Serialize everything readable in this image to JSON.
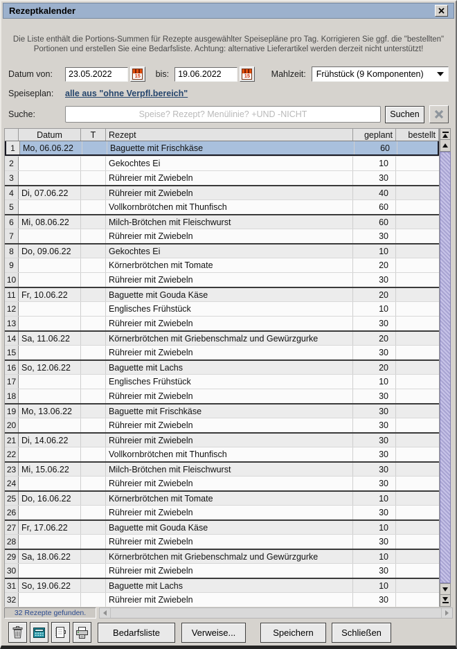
{
  "window": {
    "title": "Rezeptkalender"
  },
  "description": {
    "line1": "Die Liste enthält die Portions-Summen für Rezepte ausgewählter Speisepläne pro Tag. Korrigieren Sie ggf. die \"bestellten\"",
    "line2": "Portionen und erstellen Sie eine Bedarfsliste. Achtung: alternative Lieferartikel werden derzeit nicht unterstützt!"
  },
  "filters": {
    "date_from_label": "Datum von:",
    "date_from_value": "23.05.2022",
    "date_to_label": "bis:",
    "date_to_value": "19.06.2022",
    "calendar_day": "15",
    "meal_label": "Mahlzeit:",
    "meal_value": "Frühstück (9 Komponenten)",
    "mealplan_label": "Speiseplan:",
    "mealplan_link": "alle aus \"ohne Verpfl.bereich\"",
    "search_label": "Suche:",
    "search_placeholder": "Speise? Rezept? Menülinie? +UND -NICHT",
    "search_button": "Suchen"
  },
  "table": {
    "columns": [
      "",
      "Datum",
      "T",
      "Rezept",
      "geplant",
      "bestellt"
    ],
    "rows": [
      {
        "num": 1,
        "date": "Mo, 06.06.22",
        "t": "",
        "recipe": "Baguette mit Frischkäse",
        "planned": "60",
        "ordered": "",
        "day_start": true,
        "selected": true
      },
      {
        "num": 2,
        "date": "",
        "t": "",
        "recipe": "Gekochtes Ei",
        "planned": "10",
        "ordered": "",
        "day_start": false,
        "selected": false
      },
      {
        "num": 3,
        "date": "",
        "t": "",
        "recipe": "Rühreier mit Zwiebeln",
        "planned": "30",
        "ordered": "",
        "day_start": false,
        "selected": false
      },
      {
        "num": 4,
        "date": "Di, 07.06.22",
        "t": "",
        "recipe": "Rühreier mit Zwiebeln",
        "planned": "40",
        "ordered": "",
        "day_start": true,
        "selected": false
      },
      {
        "num": 5,
        "date": "",
        "t": "",
        "recipe": "Vollkornbrötchen mit Thunfisch",
        "planned": "60",
        "ordered": "",
        "day_start": false,
        "selected": false
      },
      {
        "num": 6,
        "date": "Mi, 08.06.22",
        "t": "",
        "recipe": "Milch-Brötchen mit Fleischwurst",
        "planned": "60",
        "ordered": "",
        "day_start": true,
        "selected": false
      },
      {
        "num": 7,
        "date": "",
        "t": "",
        "recipe": "Rühreier mit Zwiebeln",
        "planned": "30",
        "ordered": "",
        "day_start": false,
        "selected": false
      },
      {
        "num": 8,
        "date": "Do, 09.06.22",
        "t": "",
        "recipe": "Gekochtes Ei",
        "planned": "10",
        "ordered": "",
        "day_start": true,
        "selected": false
      },
      {
        "num": 9,
        "date": "",
        "t": "",
        "recipe": "Körnerbrötchen mit Tomate",
        "planned": "20",
        "ordered": "",
        "day_start": false,
        "selected": false
      },
      {
        "num": 10,
        "date": "",
        "t": "",
        "recipe": "Rühreier mit Zwiebeln",
        "planned": "30",
        "ordered": "",
        "day_start": false,
        "selected": false
      },
      {
        "num": 11,
        "date": "Fr, 10.06.22",
        "t": "",
        "recipe": "Baguette mit Gouda Käse",
        "planned": "20",
        "ordered": "",
        "day_start": true,
        "selected": false
      },
      {
        "num": 12,
        "date": "",
        "t": "",
        "recipe": "Englisches Frühstück",
        "planned": "10",
        "ordered": "",
        "day_start": false,
        "selected": false
      },
      {
        "num": 13,
        "date": "",
        "t": "",
        "recipe": "Rühreier mit Zwiebeln",
        "planned": "30",
        "ordered": "",
        "day_start": false,
        "selected": false
      },
      {
        "num": 14,
        "date": "Sa, 11.06.22",
        "t": "",
        "recipe": "Körnerbrötchen mit Griebenschmalz und Gewürzgurke",
        "planned": "20",
        "ordered": "",
        "day_start": true,
        "selected": false
      },
      {
        "num": 15,
        "date": "",
        "t": "",
        "recipe": "Rühreier mit Zwiebeln",
        "planned": "30",
        "ordered": "",
        "day_start": false,
        "selected": false
      },
      {
        "num": 16,
        "date": "So, 12.06.22",
        "t": "",
        "recipe": "Baguette mit Lachs",
        "planned": "20",
        "ordered": "",
        "day_start": true,
        "selected": false
      },
      {
        "num": 17,
        "date": "",
        "t": "",
        "recipe": "Englisches Frühstück",
        "planned": "10",
        "ordered": "",
        "day_start": false,
        "selected": false
      },
      {
        "num": 18,
        "date": "",
        "t": "",
        "recipe": "Rühreier mit Zwiebeln",
        "planned": "30",
        "ordered": "",
        "day_start": false,
        "selected": false
      },
      {
        "num": 19,
        "date": "Mo, 13.06.22",
        "t": "",
        "recipe": "Baguette mit Frischkäse",
        "planned": "30",
        "ordered": "",
        "day_start": true,
        "selected": false
      },
      {
        "num": 20,
        "date": "",
        "t": "",
        "recipe": "Rühreier mit Zwiebeln",
        "planned": "30",
        "ordered": "",
        "day_start": false,
        "selected": false
      },
      {
        "num": 21,
        "date": "Di, 14.06.22",
        "t": "",
        "recipe": "Rühreier mit Zwiebeln",
        "planned": "30",
        "ordered": "",
        "day_start": true,
        "selected": false
      },
      {
        "num": 22,
        "date": "",
        "t": "",
        "recipe": "Vollkornbrötchen mit Thunfisch",
        "planned": "30",
        "ordered": "",
        "day_start": false,
        "selected": false
      },
      {
        "num": 23,
        "date": "Mi, 15.06.22",
        "t": "",
        "recipe": "Milch-Brötchen mit Fleischwurst",
        "planned": "30",
        "ordered": "",
        "day_start": true,
        "selected": false
      },
      {
        "num": 24,
        "date": "",
        "t": "",
        "recipe": "Rühreier mit Zwiebeln",
        "planned": "30",
        "ordered": "",
        "day_start": false,
        "selected": false
      },
      {
        "num": 25,
        "date": "Do, 16.06.22",
        "t": "",
        "recipe": "Körnerbrötchen mit Tomate",
        "planned": "10",
        "ordered": "",
        "day_start": true,
        "selected": false
      },
      {
        "num": 26,
        "date": "",
        "t": "",
        "recipe": "Rühreier mit Zwiebeln",
        "planned": "30",
        "ordered": "",
        "day_start": false,
        "selected": false
      },
      {
        "num": 27,
        "date": "Fr, 17.06.22",
        "t": "",
        "recipe": "Baguette mit Gouda Käse",
        "planned": "10",
        "ordered": "",
        "day_start": true,
        "selected": false
      },
      {
        "num": 28,
        "date": "",
        "t": "",
        "recipe": "Rühreier mit Zwiebeln",
        "planned": "30",
        "ordered": "",
        "day_start": false,
        "selected": false
      },
      {
        "num": 29,
        "date": "Sa, 18.06.22",
        "t": "",
        "recipe": "Körnerbrötchen mit Griebenschmalz und Gewürzgurke",
        "planned": "10",
        "ordered": "",
        "day_start": true,
        "selected": false
      },
      {
        "num": 30,
        "date": "",
        "t": "",
        "recipe": "Rühreier mit Zwiebeln",
        "planned": "30",
        "ordered": "",
        "day_start": false,
        "selected": false
      },
      {
        "num": 31,
        "date": "So, 19.06.22",
        "t": "",
        "recipe": "Baguette mit Lachs",
        "planned": "10",
        "ordered": "",
        "day_start": true,
        "selected": false
      },
      {
        "num": 32,
        "date": "",
        "t": "",
        "recipe": "Rühreier mit Zwiebeln",
        "planned": "30",
        "ordered": "",
        "day_start": false,
        "selected": false
      }
    ]
  },
  "status": {
    "text": "32  Rezepte gefunden."
  },
  "footer": {
    "buttons": [
      {
        "label": "Bedarfsliste"
      },
      {
        "label": "Verweise..."
      },
      {
        "label": "Speichern"
      },
      {
        "label": "Schließen"
      }
    ]
  }
}
